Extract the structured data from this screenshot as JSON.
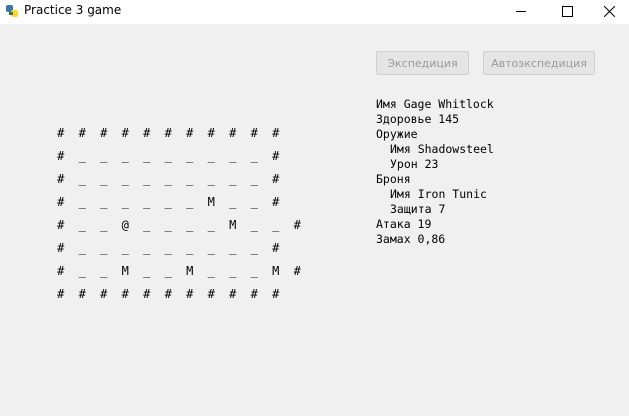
{
  "window": {
    "title": "Practice 3 game",
    "app_icon": "python-icon",
    "minimize_icon": "minimize-icon",
    "maximize_icon": "maximize-icon",
    "close_icon": "close-icon"
  },
  "actions": {
    "expedition_label": "Экспедиция",
    "autoexpedition_label": "Автоэкспедиция",
    "disabled_color": "#9a9a9a"
  },
  "map": {
    "rows": [
      "###########",
      "#_________#",
      "#_________#",
      "#______M__#",
      "#__@____M__#",
      "#_________#",
      "#__M__M___M#",
      "###########"
    ]
  },
  "player": {
    "name_line": "Имя Gage Whitlock",
    "health_line": "Здоровье 145",
    "weapon_header": "Оружие",
    "weapon_name_line": "Имя Shadowsteel",
    "weapon_damage_line": "Урон 23",
    "armor_header": "Броня",
    "armor_name_line": "Имя Iron Tunic",
    "armor_defense_line": "Защита 7",
    "attack_line": "Атака 19",
    "swing_line": "Замах 0,86"
  }
}
